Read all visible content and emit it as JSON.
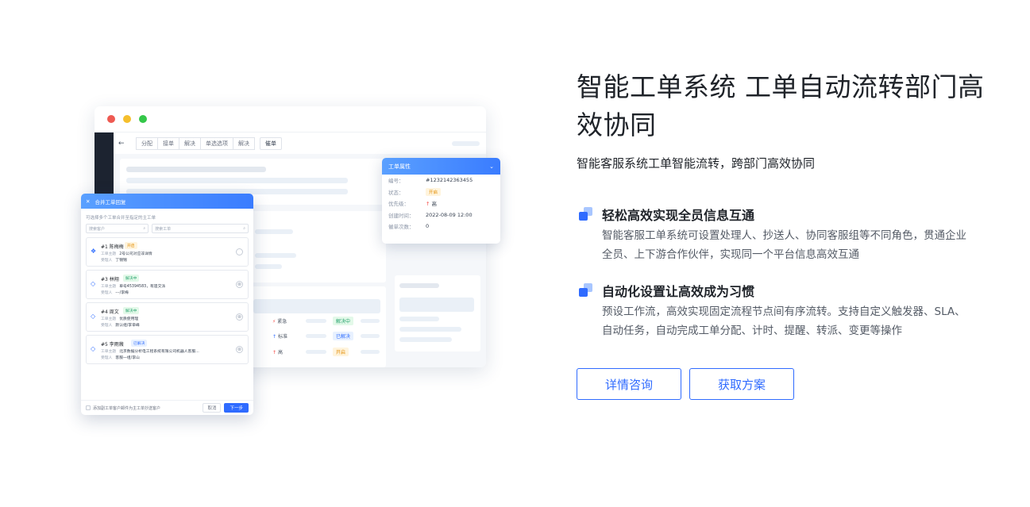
{
  "hero": {
    "title": "智能工单系统 工单自动流转部门高效协同",
    "subtitle": "智能客服系统工单智能流转，跨部门高效协同"
  },
  "features": [
    {
      "title": "轻松高效实现全员信息互通",
      "desc": "智能客服工单系统可设置处理人、抄送人、协同客服组等不同角色，贯通企业全员、上下游合作伙伴，实现同一个平台信息高效互通"
    },
    {
      "title": "自动化设置让高效成为习惯",
      "desc": "预设工作流，高效实现固定流程节点间有序流转。支持自定义触发器、SLA、自动任务，自动完成工单分配、计时、提醒、转派、变更等操作"
    }
  ],
  "buttons": {
    "consult": "详情咨询",
    "solution": "获取方案"
  },
  "mock": {
    "toolbar": {
      "back": "←",
      "tabs": [
        "分配",
        "接单",
        "解决",
        "单选选项",
        "解决"
      ],
      "solo": "催单"
    },
    "table": {
      "priorities": [
        {
          "icon": "⚡",
          "label": "紧急",
          "icon_color": "#f54a45"
        },
        {
          "icon": "↑",
          "label": "标准",
          "icon_color": "#3370ff"
        },
        {
          "icon": "↑",
          "label": "高",
          "icon_color": "#f54a45"
        }
      ],
      "statuses": [
        {
          "label": "解决中",
          "color": "green"
        },
        {
          "label": "已解决",
          "color": "blue"
        },
        {
          "label": "开启",
          "color": "orange"
        }
      ]
    },
    "prop": {
      "title": "工单属性",
      "rows": [
        {
          "k": "编号：",
          "v": "#1232142363455"
        },
        {
          "k": "状态：",
          "v": "开启"
        },
        {
          "k": "优先级：",
          "v": "高"
        },
        {
          "k": "创建时间：",
          "v": "2022-08-09 12:00"
        },
        {
          "k": "催单次数：",
          "v": "0"
        }
      ]
    },
    "dialog": {
      "close": "✕",
      "title": "合并工单回复",
      "hint": "可选择多个工单合并至指定的主工单",
      "search1": "搜索客户",
      "search2": "搜索工单",
      "cards": [
        {
          "name": "#1 陈梅梅",
          "status": "开启",
          "status_color": "orange",
          "l1k": "工单主题",
          "l1v": "2号公司对应非详情",
          "l2k": "受理人",
          "l2v": "丁锦锦"
        },
        {
          "name": "#3 林翔",
          "status": "解决中",
          "status_color": "green",
          "l1k": "工单主题",
          "l1v": "单号45394583，有遗交派",
          "l2k": "受理人",
          "l2v": "---/李梅"
        },
        {
          "name": "#4 周文",
          "status": "解决中",
          "status_color": "green",
          "l1k": "工单主题",
          "l1v": "优质使用理",
          "l2k": "受理人",
          "l2v": "默认组/李章峰"
        },
        {
          "name": "#5 李雨薇",
          "status": "已解决",
          "status_color": "blue",
          "l1k": "工单主题",
          "l1v": "北京数据分析电工程系统有限公司机器人客服...",
          "l2k": "受理人",
          "l2v": "客服一组/李山"
        }
      ],
      "footer_check": "添加副工单客户邮件为主工单抄送客户",
      "cancel": "取消",
      "next": "下一步"
    }
  }
}
